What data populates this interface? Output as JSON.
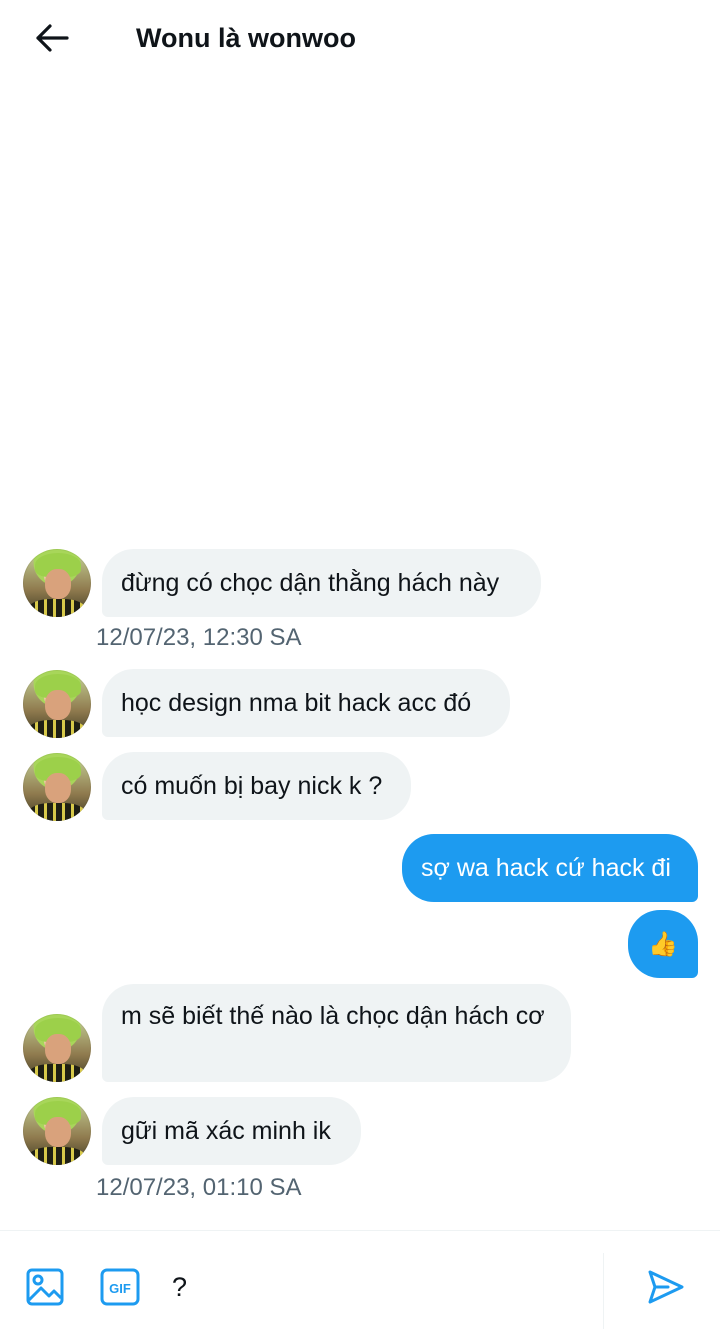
{
  "header": {
    "title": "Wonu là wonwoo"
  },
  "messages": [
    {
      "side": "in",
      "text": "đừng có chọc dận thằng hách này"
    },
    {
      "side": "timestamp",
      "text": "12/07/23, 12:30 SA"
    },
    {
      "side": "in",
      "text": "học design nma bit hack acc đó"
    },
    {
      "side": "in",
      "text": "có muốn bị bay nick k ?"
    },
    {
      "side": "out",
      "text": "sợ wa hack cứ hack đi"
    },
    {
      "side": "out",
      "text": "👍"
    },
    {
      "side": "in",
      "text": "m sẽ biết thế nào là chọc dận hách cơ"
    },
    {
      "side": "in",
      "text": "gữi mã xác minh ik"
    },
    {
      "side": "timestamp",
      "text": "12/07/23, 01:10 SA"
    }
  ],
  "composer": {
    "value": "?",
    "gif_label": "GIF"
  },
  "colors": {
    "accent": "#1d9bf0",
    "incoming_bubble": "#eff3f4",
    "timestamp_text": "#536471"
  },
  "icons": {
    "back": "arrow-left-icon",
    "image": "image-icon",
    "gif": "gif-icon",
    "send": "send-icon"
  }
}
